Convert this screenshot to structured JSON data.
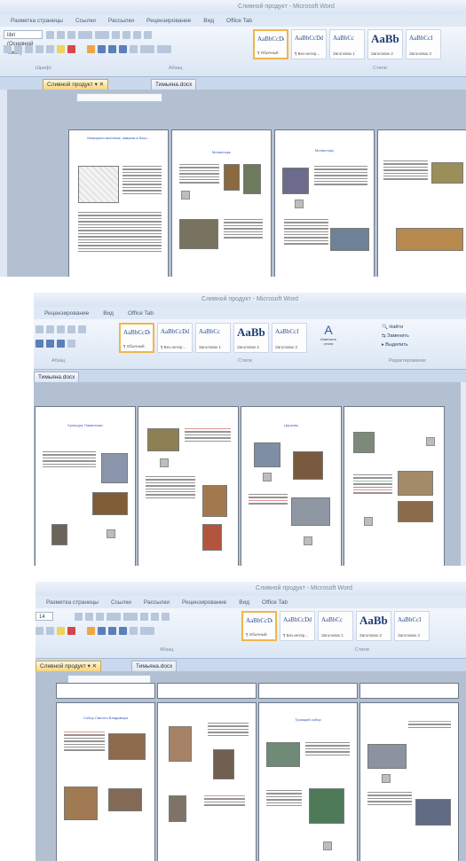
{
  "window": {
    "title": "Сливной продукт - Microsoft Word",
    "title_short": "Сливной продукт - Microsoft Word"
  },
  "menu_full": [
    "Разметка страницы",
    "Ссылки",
    "Рассылки",
    "Рецензирование",
    "Вид",
    "Office Tab"
  ],
  "menu_short": [
    "Рецензирование",
    "Вид",
    "Office Tab"
  ],
  "font": {
    "name": "libri (Основной текст)",
    "size": "14"
  },
  "ribbon_groups": {
    "font": "Шрифт",
    "paragraph": "Абзац",
    "styles": "Стили",
    "editing": "Редактирование"
  },
  "styles": [
    {
      "sample": "AaBbCcDd",
      "name": "¶ Обычный"
    },
    {
      "sample": "AaBbCcDd",
      "name": "¶ Без интер..."
    },
    {
      "sample": "AaBbCc",
      "name": "Заголовок 1"
    },
    {
      "sample": "AaBb",
      "name": "Заголовок 2"
    },
    {
      "sample": "AaBbCcI",
      "name": "Заголовок 3"
    }
  ],
  "editing": {
    "find": "Найти",
    "replace": "Заменить",
    "select": "Выделить",
    "change_styles": "Изменить стили"
  },
  "doc_tabs": [
    "Сливной продукт",
    "Тимьяна.docx"
  ],
  "pages": {
    "shot1": [
      {
        "title": "Мемориал военным, павшим в боях...",
        "kind": "map"
      },
      {
        "title": "Монастырь",
        "kind": "photos"
      },
      {
        "title": "Монастырь",
        "kind": "photos"
      },
      {
        "title": "",
        "kind": "photos"
      }
    ],
    "shot2": [
      {
        "title": "Культура. Памятники",
        "kind": "church"
      },
      {
        "title": "",
        "kind": "photos"
      },
      {
        "title": "Церковь",
        "kind": "church"
      },
      {
        "title": "",
        "kind": "photos"
      }
    ],
    "shot3": [
      {
        "title": "Собор Святого Владимира",
        "kind": "frescoes"
      },
      {
        "title": "",
        "kind": "frescoes"
      },
      {
        "title": "Троицкий собор",
        "kind": "church"
      },
      {
        "title": "",
        "kind": "church"
      }
    ]
  },
  "colors": {
    "accent": "#f0b64a",
    "ribbon": "#dbe6f4",
    "workspace": "#b3c0d2"
  }
}
